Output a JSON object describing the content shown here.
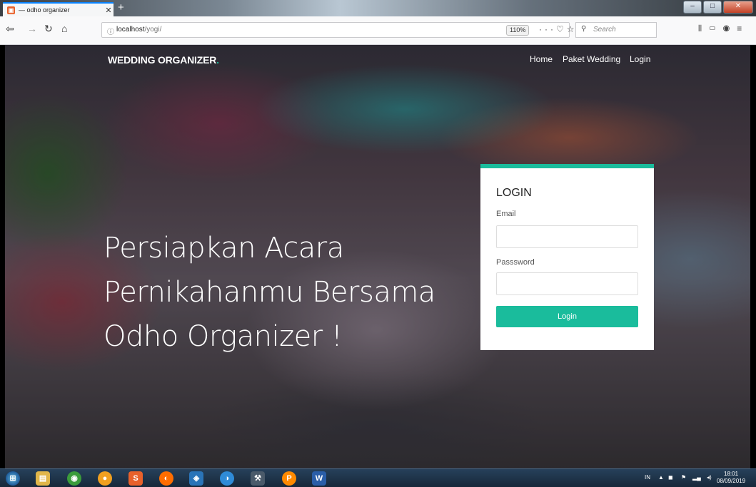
{
  "browser": {
    "tab_title": "— odho organizer",
    "url_host": "localhost",
    "url_path": "/yogi/",
    "zoom": "110%",
    "search_placeholder": "Search"
  },
  "site": {
    "brand": "WEDDING ORGANIZER",
    "brand_dot": ".",
    "nav": [
      "Home",
      "Paket Wedding",
      "Login"
    ],
    "hero_lines": [
      "Persiapkan Acara",
      "Pernikahanmu Bersama",
      "Odho Organizer !"
    ],
    "accent_color": "#1abc9c"
  },
  "login": {
    "title": "LOGIN",
    "email_label": "Email",
    "password_label": "Passsword",
    "button_label": "Login"
  },
  "taskbar": {
    "lang": "IN",
    "time": "18:01",
    "date": "08/09/2019"
  }
}
